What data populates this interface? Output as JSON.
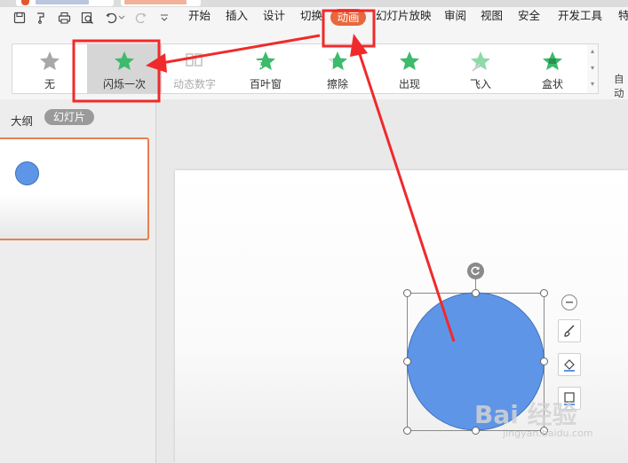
{
  "menu": {
    "items": [
      {
        "label": "开始"
      },
      {
        "label": "插入"
      },
      {
        "label": "设计"
      },
      {
        "label": "切换"
      },
      {
        "label": "动画"
      },
      {
        "label": "幻灯片放映"
      },
      {
        "label": "审阅"
      },
      {
        "label": "视图"
      },
      {
        "label": "安全"
      },
      {
        "label": "开发工具"
      },
      {
        "label": "特"
      }
    ],
    "active": "动画"
  },
  "ribbon": {
    "animations": [
      {
        "label": "无",
        "icon": "star-gray-icon"
      },
      {
        "label": "闪烁一次",
        "icon": "star-green-icon",
        "selected": true
      },
      {
        "label": "动态数字",
        "icon": "number-icon",
        "disabled": true
      },
      {
        "label": "百叶窗",
        "icon": "star-blinds-icon"
      },
      {
        "label": "擦除",
        "icon": "star-wipe-icon"
      },
      {
        "label": "出现",
        "icon": "star-green-icon"
      },
      {
        "label": "飞入",
        "icon": "star-fly-icon"
      },
      {
        "label": "盒状",
        "icon": "star-box-icon"
      }
    ],
    "auto_label": "自动"
  },
  "leftpanel": {
    "outline_label": "大纲",
    "slides_label": "幻灯片"
  },
  "watermark": {
    "text": "Bai  经验",
    "sub": "jingyan.baidu.com"
  },
  "colors": {
    "accent": "#e8673c",
    "annotation": "#f02a2a",
    "shape_fill": "#5f95e6",
    "star_green": "#3dba6b",
    "star_gray": "#a8a8a8"
  }
}
